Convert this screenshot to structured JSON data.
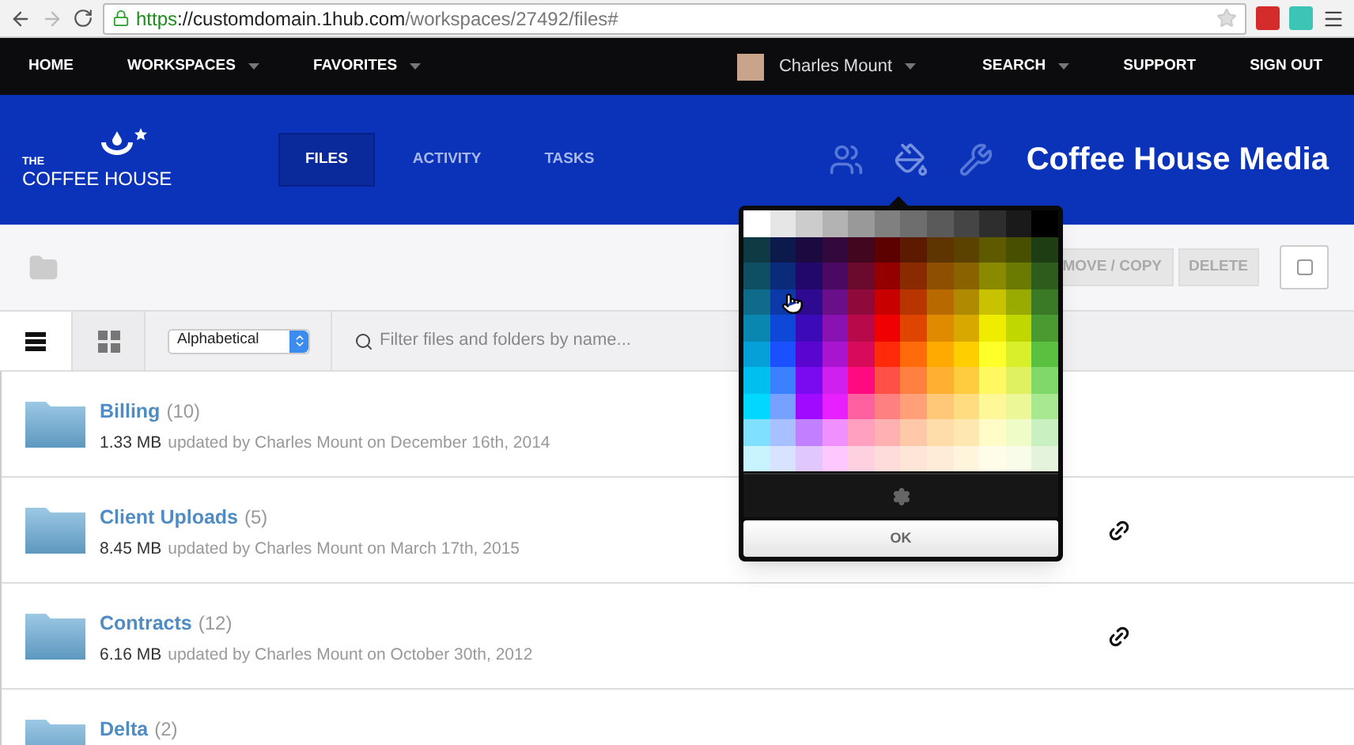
{
  "browser": {
    "url_scheme": "https",
    "url_host": "://customdomain.1hub.com",
    "url_path": "/workspaces/27492/files#"
  },
  "nav": {
    "left": [
      {
        "label": "HOME",
        "dropdown": false
      },
      {
        "label": "WORKSPACES",
        "dropdown": true
      },
      {
        "label": "FAVORITES",
        "dropdown": true
      }
    ],
    "user": {
      "name": "Charles Mount",
      "dropdown": true
    },
    "right": [
      {
        "label": "SEARCH",
        "dropdown": true
      },
      {
        "label": "SUPPORT",
        "dropdown": false
      },
      {
        "label": "SIGN OUT",
        "dropdown": false
      }
    ]
  },
  "header": {
    "logo": {
      "line1": "THE",
      "line2": "COFFEE HOUSE"
    },
    "tabs": [
      {
        "label": "FILES",
        "selected": true
      },
      {
        "label": "ACTIVITY",
        "selected": false
      },
      {
        "label": "TASKS",
        "selected": false
      }
    ],
    "title": "Coffee House Media"
  },
  "toolbar": {
    "buttons": [
      "MOVE / COPY",
      "DELETE"
    ],
    "select_all": {
      "checked": false
    }
  },
  "filter": {
    "views": [
      {
        "kind": "list",
        "selected": true
      },
      {
        "kind": "grid",
        "selected": false
      }
    ],
    "sort": "Alphabetical",
    "search": {
      "placeholder": "Filter files and folders by name..."
    }
  },
  "rows": [
    {
      "name": "Billing",
      "count": "(10)",
      "size": "1.33 MB",
      "meta": "updated by Charles Mount on December 16th, 2014",
      "link": false
    },
    {
      "name": "Client Uploads",
      "count": "(5)",
      "size": "8.45 MB",
      "meta": "updated by Charles Mount on March 17th, 2015",
      "link": true
    },
    {
      "name": "Contracts",
      "count": "(12)",
      "size": "6.16 MB",
      "meta": "updated by Charles Mount on October 30th, 2012",
      "link": true
    },
    {
      "name": "Delta",
      "count": "(2)",
      "size": "",
      "meta": "",
      "link": false
    }
  ],
  "color_picker": {
    "ok": "OK",
    "rows": [
      {
        "swatches": [
          {
            "color": "#ffffff"
          },
          {
            "color": "#e6e6e6"
          },
          {
            "color": "#cccccc"
          },
          {
            "color": "#b3b3b3"
          },
          {
            "color": "#999999"
          },
          {
            "color": "#808080"
          },
          {
            "color": "#6e6e6e"
          },
          {
            "color": "#5a5a5a"
          },
          {
            "color": "#454545"
          },
          {
            "color": "#2e2e2e"
          },
          {
            "color": "#1a1a1a"
          },
          {
            "color": "#000000"
          }
        ]
      },
      {
        "swatches": [
          {
            "color": "#0d3a45"
          },
          {
            "color": "#0b1a4a"
          },
          {
            "color": "#1a0a40"
          },
          {
            "color": "#33083d"
          },
          {
            "color": "#42061e"
          },
          {
            "color": "#5c0000"
          },
          {
            "color": "#5c1a00"
          },
          {
            "color": "#5e3500"
          },
          {
            "color": "#5c4200"
          },
          {
            "color": "#5e5a00"
          },
          {
            "color": "#485000"
          },
          {
            "color": "#1e3d12"
          }
        ]
      },
      {
        "swatches": [
          {
            "color": "#0e4f63"
          },
          {
            "color": "#0a2a7a"
          },
          {
            "color": "#22086a"
          },
          {
            "color": "#4a0a63"
          },
          {
            "color": "#6b0a2c"
          },
          {
            "color": "#940000"
          },
          {
            "color": "#8a2a00"
          },
          {
            "color": "#8f4f00"
          },
          {
            "color": "#8a6300"
          },
          {
            "color": "#8a8a00"
          },
          {
            "color": "#6b7a00"
          },
          {
            "color": "#2d5c1c"
          }
        ]
      },
      {
        "swatches": [
          {
            "color": "#0e6c8a"
          },
          {
            "color": "#0b3aa8"
          },
          {
            "color": "#2d0a8f"
          },
          {
            "color": "#6a0f8a"
          },
          {
            "color": "#8f0a3a"
          },
          {
            "color": "#c80000"
          },
          {
            "color": "#b83500"
          },
          {
            "color": "#b86a00"
          },
          {
            "color": "#b08a00"
          },
          {
            "color": "#c8c200"
          },
          {
            "color": "#99ab00"
          },
          {
            "color": "#3a7a26"
          }
        ]
      },
      {
        "swatches": [
          {
            "color": "#0a87b0"
          },
          {
            "color": "#0d48d8"
          },
          {
            "color": "#3c0ab8"
          },
          {
            "color": "#8a12b3"
          },
          {
            "color": "#b80a4a"
          },
          {
            "color": "#f00000"
          },
          {
            "color": "#e04500"
          },
          {
            "color": "#e08a00"
          },
          {
            "color": "#d8a800"
          },
          {
            "color": "#f0ec00"
          },
          {
            "color": "#c0d800"
          },
          {
            "color": "#4a9a32"
          }
        ]
      },
      {
        "swatches": [
          {
            "color": "#05a0d8"
          },
          {
            "color": "#1a50ff"
          },
          {
            "color": "#5a05d0"
          },
          {
            "color": "#a814d0"
          },
          {
            "color": "#d80a5a"
          },
          {
            "color": "#ff2a0a"
          },
          {
            "color": "#ff6a0a"
          },
          {
            "color": "#ffaa00"
          },
          {
            "color": "#ffce00"
          },
          {
            "color": "#ffff2a"
          },
          {
            "color": "#d8f02a"
          },
          {
            "color": "#5ac040"
          }
        ]
      },
      {
        "swatches": [
          {
            "color": "#00c0f0"
          },
          {
            "color": "#3a80ff"
          },
          {
            "color": "#7a0af0"
          },
          {
            "color": "#d020f0"
          },
          {
            "color": "#ff0a80"
          },
          {
            "color": "#ff5048"
          },
          {
            "color": "#ff8040"
          },
          {
            "color": "#ffb030"
          },
          {
            "color": "#ffcc40"
          },
          {
            "color": "#fff860"
          },
          {
            "color": "#e0f060"
          },
          {
            "color": "#80d868"
          }
        ]
      },
      {
        "swatches": [
          {
            "color": "#00d8ff"
          },
          {
            "color": "#78a0ff"
          },
          {
            "color": "#a00aff"
          },
          {
            "color": "#e820ff"
          },
          {
            "color": "#ff60a0"
          },
          {
            "color": "#ff8080"
          },
          {
            "color": "#ffa078"
          },
          {
            "color": "#ffc878"
          },
          {
            "color": "#ffdc80"
          },
          {
            "color": "#fff898"
          },
          {
            "color": "#ecf898"
          },
          {
            "color": "#a8e890"
          }
        ]
      },
      {
        "swatches": [
          {
            "color": "#80e0ff"
          },
          {
            "color": "#a8c0ff"
          },
          {
            "color": "#c080ff"
          },
          {
            "color": "#f090ff"
          },
          {
            "color": "#ffa0c0"
          },
          {
            "color": "#ffb0b0"
          },
          {
            "color": "#ffc8a8"
          },
          {
            "color": "#ffdca8"
          },
          {
            "color": "#ffe8b0"
          },
          {
            "color": "#fffcc8"
          },
          {
            "color": "#f0fcc8"
          },
          {
            "color": "#c8f0c0"
          }
        ]
      },
      {
        "swatches": [
          {
            "color": "#c8f4ff"
          },
          {
            "color": "#d8e4ff"
          },
          {
            "color": "#e0c8ff"
          },
          {
            "color": "#fcc8ff"
          },
          {
            "color": "#ffd0e0"
          },
          {
            "color": "#ffdcdc"
          },
          {
            "color": "#ffe4d8"
          },
          {
            "color": "#ffecd8"
          },
          {
            "color": "#fff4dc"
          },
          {
            "color": "#fffce8"
          },
          {
            "color": "#f8fce8"
          },
          {
            "color": "#e4f4dc"
          }
        ]
      }
    ]
  }
}
